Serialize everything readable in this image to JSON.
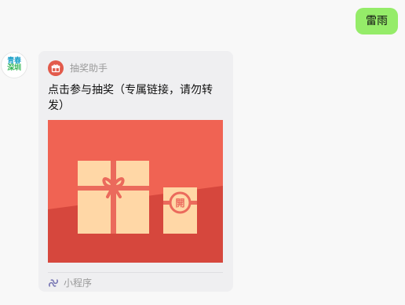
{
  "chat": {
    "outgoing": {
      "text": "雷雨",
      "bubble_color": "#95ec69"
    },
    "incoming": {
      "avatar": {
        "text_line1": "青春",
        "text_line2": "深圳",
        "colors": {
          "line1": "#1aa0c8",
          "line2": "#2cb34f",
          "border": "#e6e6e6"
        }
      },
      "card": {
        "app": {
          "name": "抽奖助手",
          "icon": "gift-icon",
          "icon_bg": "#e25a4b"
        },
        "title": "点击参与抽奖（专属链接，请勿转发）",
        "cover": {
          "seal_char": "開",
          "icons": [
            "gift-box-large-icon",
            "gift-box-small-icon",
            "bow-icon",
            "seal-icon"
          ],
          "colors": {
            "background": "#f06353",
            "shadow": "#d6473d",
            "box": "#ffd7a6",
            "ribbon": "#eb6a5c"
          }
        },
        "footer": {
          "icon": "mini-program-icon",
          "label": "小程序"
        },
        "bg_color": "#efeff1"
      }
    }
  }
}
